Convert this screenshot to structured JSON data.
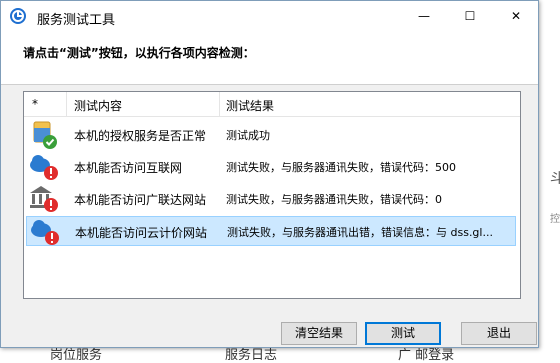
{
  "window": {
    "title": "服务测试工具",
    "controls": {
      "minimize": "—",
      "maximize": "☐",
      "close": "✕"
    }
  },
  "instruction": "请点击“测试”按钮，以执行各项内容检测：",
  "list": {
    "columns": {
      "star": "*",
      "content": "测试内容",
      "result": "测试结果"
    },
    "rows": [
      {
        "icon": "database-check-icon",
        "content": "本机的授权服务是否正常",
        "result": "测试成功",
        "selected": false
      },
      {
        "icon": "cloud-error-icon",
        "content": "本机能否访问互联网",
        "result": "测试失败，与服务器通讯失败，错误代码：500",
        "selected": false
      },
      {
        "icon": "bank-error-icon",
        "content": "本机能否访问广联达网站",
        "result": "测试失败，与服务器通讯失败，错误代码：0",
        "selected": false
      },
      {
        "icon": "cloud-error-icon",
        "content": "本机能否访问云计价网站",
        "result": "测试失败，与服务器通讯出错，错误信息：与 dss.gl...",
        "selected": true
      }
    ]
  },
  "buttons": {
    "clear": "清空结果",
    "test": "测试",
    "exit": "退出"
  },
  "background": {
    "bottom_texts": [
      "岗位服务",
      "服务日志",
      "广 邮登录"
    ],
    "right_glyph": "斗",
    "right_glyph2": "控"
  },
  "colors": {
    "selected_bg": "#cce8ff",
    "accent": "#0078d7",
    "error": "#e02d2d",
    "success": "#3a9f3a"
  }
}
